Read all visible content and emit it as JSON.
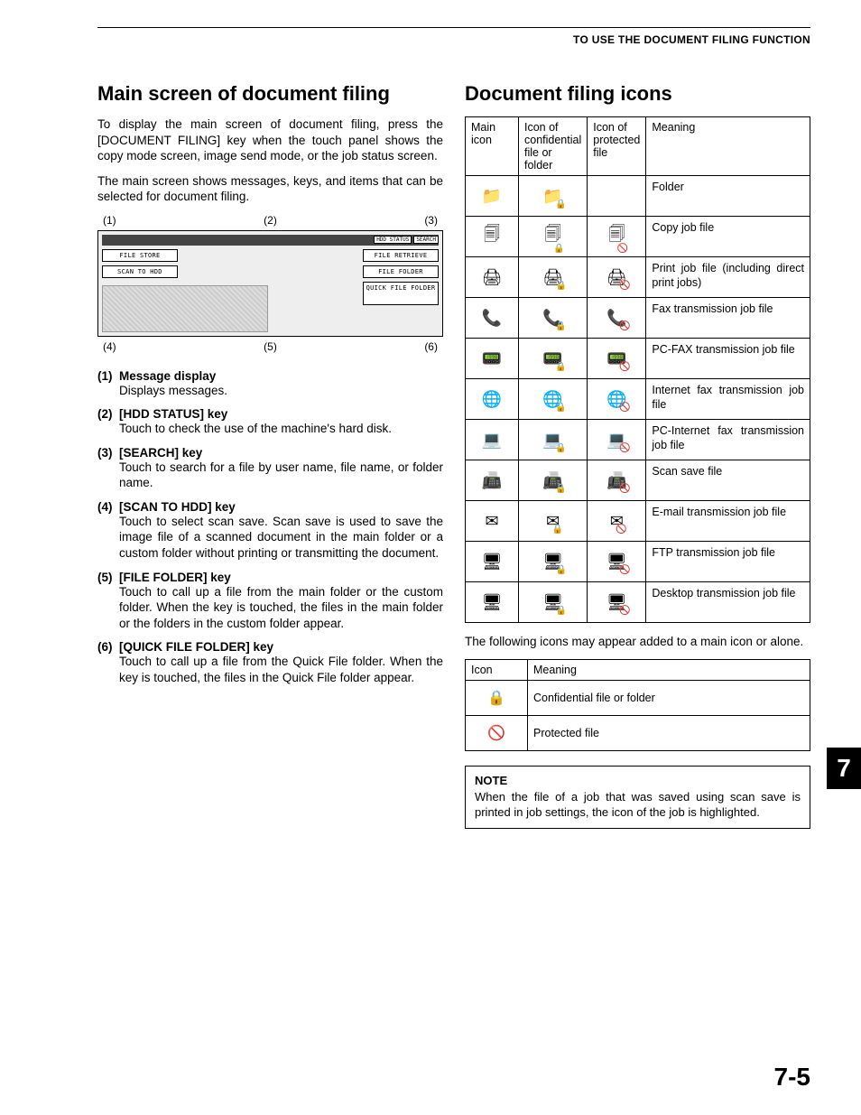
{
  "header": "TO USE THE DOCUMENT FILING FUNCTION",
  "left": {
    "title": "Main screen of document filing",
    "p1": "To display the main screen of document filing, press the [DOCUMENT FILING] key when the touch panel shows the copy mode screen, image send mode, or the job status screen.",
    "p2": "The main screen shows messages, keys, and items that can be selected for document filing.",
    "diagram": {
      "top_anns": [
        "(1)",
        "(2)",
        "(3)"
      ],
      "bot_anns": [
        "(4)",
        "(5)",
        "(6)"
      ],
      "btn_hdd": "HDD STATUS",
      "btn_search": "SEARCH",
      "btn_store": "FILE STORE",
      "btn_scan": "SCAN TO HDD",
      "btn_retrieve": "FILE RETRIEVE",
      "btn_filefolder": "FILE FOLDER",
      "btn_quick": "QUICK FILE FOLDER"
    },
    "defs": [
      {
        "n": "(1)",
        "t": "Message display",
        "d": "Displays messages."
      },
      {
        "n": "(2)",
        "t": "[HDD STATUS] key",
        "d": "Touch to check the use of the machine's hard disk."
      },
      {
        "n": "(3)",
        "t": "[SEARCH] key",
        "d": "Touch to search for a file by user name, file name, or folder name."
      },
      {
        "n": "(4)",
        "t": "[SCAN TO HDD] key",
        "d": "Touch to select scan save. Scan save is used to save the image file of a scanned document in the main folder or a custom folder without printing or transmitting the document."
      },
      {
        "n": "(5)",
        "t": "[FILE FOLDER] key",
        "d": "Touch to call up a file from the main folder or the custom folder. When the key is touched, the files in the main folder or the folders in the custom folder appear."
      },
      {
        "n": "(6)",
        "t": "[QUICK FILE FOLDER] key",
        "d": "Touch to call up a file from the Quick File folder. When the key is touched, the files in the Quick File folder appear."
      }
    ]
  },
  "right": {
    "title": "Document filing icons",
    "table_head": {
      "c1": "Main icon",
      "c2": "Icon of confidential file or folder",
      "c3": "Icon of protected file",
      "c4": "Meaning"
    },
    "rows": [
      {
        "main": "📁",
        "conf": "📁🔒",
        "prot": "",
        "meaning": "Folder"
      },
      {
        "main": "🗐",
        "conf": "🗐🔒",
        "prot": "🗐🚫",
        "meaning": "Copy job file"
      },
      {
        "main": "🖨",
        "conf": "🖨🔒",
        "prot": "🖨🚫",
        "meaning": "Print job file (including direct print jobs)"
      },
      {
        "main": "📞",
        "conf": "📞🔒",
        "prot": "📞🚫",
        "meaning": "Fax transmission job file"
      },
      {
        "main": "📟",
        "conf": "📟🔒",
        "prot": "📟🚫",
        "meaning": "PC-FAX transmission job file"
      },
      {
        "main": "🌐",
        "conf": "🌐🔒",
        "prot": "🌐🚫",
        "meaning": "Internet fax transmission job file"
      },
      {
        "main": "💻",
        "conf": "💻🔒",
        "prot": "💻🚫",
        "meaning": "PC-Internet fax transmission job file"
      },
      {
        "main": "📠",
        "conf": "📠🔒",
        "prot": "📠🚫",
        "meaning": "Scan save file"
      },
      {
        "main": "✉",
        "conf": "✉🔒",
        "prot": "✉🚫",
        "meaning": "E-mail transmission job file"
      },
      {
        "main": "🖥",
        "conf": "🖥🔒",
        "prot": "🖥🚫",
        "meaning": "FTP transmission job file"
      },
      {
        "main": "🖥",
        "conf": "🖥🔒",
        "prot": "🖥🚫",
        "meaning": "Desktop transmission job file"
      }
    ],
    "after_table": "The following icons may appear added to a main icon or alone.",
    "table2_head": {
      "c1": "Icon",
      "c2": "Meaning"
    },
    "table2_rows": [
      {
        "icon": "🔒",
        "meaning": "Confidential file or folder"
      },
      {
        "icon": "🚫",
        "meaning": "Protected file"
      }
    ],
    "note_title": "NOTE",
    "note_body": "When the file of a job that was saved using scan save is printed in job settings, the icon of the job is highlighted."
  },
  "tab": "7",
  "pagenum": "7-5"
}
